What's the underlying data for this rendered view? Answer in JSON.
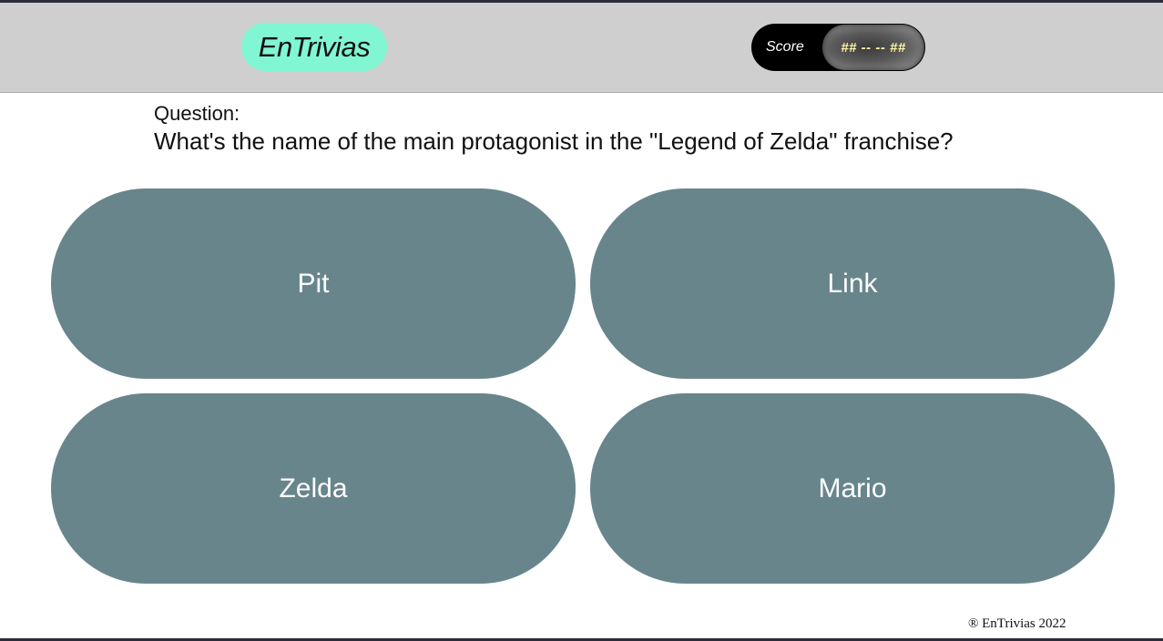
{
  "header": {
    "logo_text": "EnTrivias",
    "score_label": "Score",
    "score_value": "## -- -- ##"
  },
  "question": {
    "label": "Question:",
    "text": "What's the name of the main protagonist in the \"Legend of Zelda\" franchise?"
  },
  "answers": [
    {
      "label": "Pit"
    },
    {
      "label": "Link"
    },
    {
      "label": "Zelda"
    },
    {
      "label": "Mario"
    }
  ],
  "footer": {
    "text": "® EnTrivias 2022"
  },
  "colors": {
    "header_bg": "#cfcfcf",
    "logo_bg": "#80f7d2",
    "answer_bg": "#68858c",
    "score_bg": "#000000",
    "score_value_text": "#fff6a8"
  }
}
